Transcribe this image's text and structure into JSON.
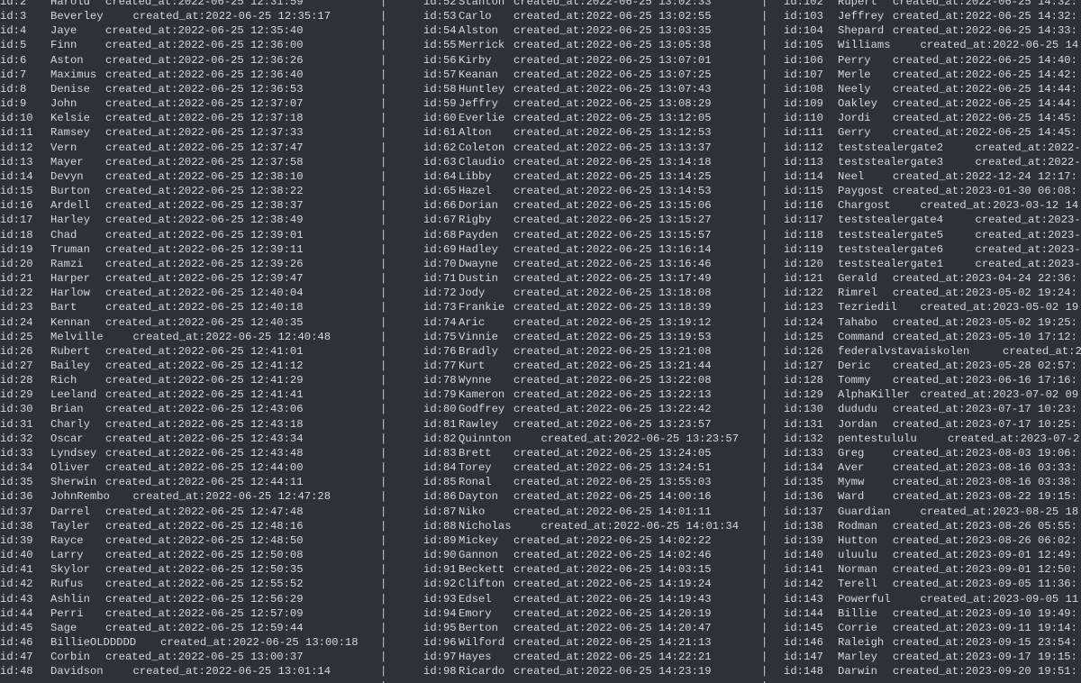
{
  "terminal": {
    "field_label": "created_at:",
    "separator": "|",
    "colors": {
      "background": "#2c313a",
      "text": "#d6d9de"
    },
    "columns": [
      {
        "rows": [
          {
            "id": "id:2",
            "name": "Harold",
            "created": "2022-06-25 12:31:59"
          },
          {
            "id": "id:3",
            "name": "Beverley",
            "created": "2022-06-25 12:35:17"
          },
          {
            "id": "id:4",
            "name": "Jaye",
            "created": "2022-06-25 12:35:40"
          },
          {
            "id": "id:5",
            "name": "Finn",
            "created": "2022-06-25 12:36:00"
          },
          {
            "id": "id:6",
            "name": "Aston",
            "created": "2022-06-25 12:36:26"
          },
          {
            "id": "id:7",
            "name": "Maximus",
            "created": "2022-06-25 12:36:40"
          },
          {
            "id": "id:8",
            "name": "Denise",
            "created": "2022-06-25 12:36:53"
          },
          {
            "id": "id:9",
            "name": "John",
            "created": "2022-06-25 12:37:07"
          },
          {
            "id": "id:10",
            "name": "Kelsie",
            "created": "2022-06-25 12:37:18"
          },
          {
            "id": "id:11",
            "name": "Ramsey",
            "created": "2022-06-25 12:37:33"
          },
          {
            "id": "id:12",
            "name": "Vern",
            "created": "2022-06-25 12:37:47"
          },
          {
            "id": "id:13",
            "name": "Mayer",
            "created": "2022-06-25 12:37:58"
          },
          {
            "id": "id:14",
            "name": "Devyn",
            "created": "2022-06-25 12:38:10"
          },
          {
            "id": "id:15",
            "name": "Burton",
            "created": "2022-06-25 12:38:22"
          },
          {
            "id": "id:16",
            "name": "Ardell",
            "created": "2022-06-25 12:38:37"
          },
          {
            "id": "id:17",
            "name": "Harley",
            "created": "2022-06-25 12:38:49"
          },
          {
            "id": "id:18",
            "name": "Chad",
            "created": "2022-06-25 12:39:01"
          },
          {
            "id": "id:19",
            "name": "Truman",
            "created": "2022-06-25 12:39:11"
          },
          {
            "id": "id:20",
            "name": "Ramzi",
            "created": "2022-06-25 12:39:26"
          },
          {
            "id": "id:21",
            "name": "Harper",
            "created": "2022-06-25 12:39:47"
          },
          {
            "id": "id:22",
            "name": "Harlow",
            "created": "2022-06-25 12:40:04"
          },
          {
            "id": "id:23",
            "name": "Bart",
            "created": "2022-06-25 12:40:18"
          },
          {
            "id": "id:24",
            "name": "Kennan",
            "created": "2022-06-25 12:40:35"
          },
          {
            "id": "id:25",
            "name": "Melville",
            "created": "2022-06-25 12:40:48"
          },
          {
            "id": "id:26",
            "name": "Rubert",
            "created": "2022-06-25 12:41:01"
          },
          {
            "id": "id:27",
            "name": "Bailey",
            "created": "2022-06-25 12:41:12"
          },
          {
            "id": "id:28",
            "name": "Rich",
            "created": "2022-06-25 12:41:29"
          },
          {
            "id": "id:29",
            "name": "Leeland",
            "created": "2022-06-25 12:41:41"
          },
          {
            "id": "id:30",
            "name": "Brian",
            "created": "2022-06-25 12:43:06"
          },
          {
            "id": "id:31",
            "name": "Charly",
            "created": "2022-06-25 12:43:18"
          },
          {
            "id": "id:32",
            "name": "Oscar",
            "created": "2022-06-25 12:43:34"
          },
          {
            "id": "id:33",
            "name": "Lyndsey",
            "created": "2022-06-25 12:43:48"
          },
          {
            "id": "id:34",
            "name": "Oliver",
            "created": "2022-06-25 12:44:00"
          },
          {
            "id": "id:35",
            "name": "Sherwin",
            "created": "2022-06-25 12:44:11"
          },
          {
            "id": "id:36",
            "name": "JohnRembo",
            "created": "2022-06-25 12:47:28"
          },
          {
            "id": "id:37",
            "name": "Darrel",
            "created": "2022-06-25 12:47:48"
          },
          {
            "id": "id:38",
            "name": "Tayler",
            "created": "2022-06-25 12:48:16"
          },
          {
            "id": "id:39",
            "name": "Rayce",
            "created": "2022-06-25 12:48:50"
          },
          {
            "id": "id:40",
            "name": "Larry",
            "created": "2022-06-25 12:50:08"
          },
          {
            "id": "id:41",
            "name": "Skylor",
            "created": "2022-06-25 12:50:35"
          },
          {
            "id": "id:42",
            "name": "Rufus",
            "created": "2022-06-25 12:55:52"
          },
          {
            "id": "id:43",
            "name": "Ashlin",
            "created": "2022-06-25 12:56:29"
          },
          {
            "id": "id:44",
            "name": "Perri",
            "created": "2022-06-25 12:57:09"
          },
          {
            "id": "id:45",
            "name": "Sage",
            "created": "2022-06-25 12:59:44"
          },
          {
            "id": "id:46",
            "name": "BillieOLDDDDD",
            "created": "2022-06-25 13:00:18"
          },
          {
            "id": "id:47",
            "name": "Corbin",
            "created": "2022-06-25 13:00:37"
          },
          {
            "id": "id:48",
            "name": "Davidson",
            "created": "2022-06-25 13:01:14"
          }
        ]
      },
      {
        "rows": [
          {
            "id": "id:52",
            "name": "Stanton",
            "created": "2022-06-25 13:02:33"
          },
          {
            "id": "id:53",
            "name": "Carlo",
            "created": "2022-06-25 13:02:55"
          },
          {
            "id": "id:54",
            "name": "Alston",
            "created": "2022-06-25 13:03:35"
          },
          {
            "id": "id:55",
            "name": "Merrick",
            "created": "2022-06-25 13:05:38"
          },
          {
            "id": "id:56",
            "name": "Kirby",
            "created": "2022-06-25 13:07:01"
          },
          {
            "id": "id:57",
            "name": "Keanan",
            "created": "2022-06-25 13:07:25"
          },
          {
            "id": "id:58",
            "name": "Huntley",
            "created": "2022-06-25 13:07:43"
          },
          {
            "id": "id:59",
            "name": "Jeffry",
            "created": "2022-06-25 13:08:29"
          },
          {
            "id": "id:60",
            "name": "Everlie",
            "created": "2022-06-25 13:12:05"
          },
          {
            "id": "id:61",
            "name": "Alton",
            "created": "2022-06-25 13:12:53"
          },
          {
            "id": "id:62",
            "name": "Coleton",
            "created": "2022-06-25 13:13:37"
          },
          {
            "id": "id:63",
            "name": "Claudio",
            "created": "2022-06-25 13:14:18"
          },
          {
            "id": "id:64",
            "name": "Libby",
            "created": "2022-06-25 13:14:25"
          },
          {
            "id": "id:65",
            "name": "Hazel",
            "created": "2022-06-25 13:14:53"
          },
          {
            "id": "id:66",
            "name": "Dorian",
            "created": "2022-06-25 13:15:06"
          },
          {
            "id": "id:67",
            "name": "Rigby",
            "created": "2022-06-25 13:15:27"
          },
          {
            "id": "id:68",
            "name": "Payden",
            "created": "2022-06-25 13:15:57"
          },
          {
            "id": "id:69",
            "name": "Hadley",
            "created": "2022-06-25 13:16:14"
          },
          {
            "id": "id:70",
            "name": "Dwayne",
            "created": "2022-06-25 13:16:46"
          },
          {
            "id": "id:71",
            "name": "Dustin",
            "created": "2022-06-25 13:17:49"
          },
          {
            "id": "id:72",
            "name": "Jody",
            "created": "2022-06-25 13:18:08"
          },
          {
            "id": "id:73",
            "name": "Frankie",
            "created": "2022-06-25 13:18:39"
          },
          {
            "id": "id:74",
            "name": "Aric",
            "created": "2022-06-25 13:19:12"
          },
          {
            "id": "id:75",
            "name": "Vinnie",
            "created": "2022-06-25 13:19:53"
          },
          {
            "id": "id:76",
            "name": "Bradly",
            "created": "2022-06-25 13:21:08"
          },
          {
            "id": "id:77",
            "name": "Kurt",
            "created": "2022-06-25 13:21:44"
          },
          {
            "id": "id:78",
            "name": "Wynne",
            "created": "2022-06-25 13:22:08"
          },
          {
            "id": "id:79",
            "name": "Kameron",
            "created": "2022-06-25 13:22:13"
          },
          {
            "id": "id:80",
            "name": "Godfrey",
            "created": "2022-06-25 13:22:42"
          },
          {
            "id": "id:81",
            "name": "Rawley",
            "created": "2022-06-25 13:23:57"
          },
          {
            "id": "id:82",
            "name": "Quinnton",
            "created": "2022-06-25 13:23:57"
          },
          {
            "id": "id:83",
            "name": "Brett",
            "created": "2022-06-25 13:24:05"
          },
          {
            "id": "id:84",
            "name": "Torey",
            "created": "2022-06-25 13:24:51"
          },
          {
            "id": "id:85",
            "name": "Ronal",
            "created": "2022-06-25 13:55:03"
          },
          {
            "id": "id:86",
            "name": "Dayton",
            "created": "2022-06-25 14:00:16"
          },
          {
            "id": "id:87",
            "name": "Niko",
            "created": "2022-06-25 14:01:11"
          },
          {
            "id": "id:88",
            "name": "Nicholas",
            "created": "2022-06-25 14:01:34"
          },
          {
            "id": "id:89",
            "name": "Mickey",
            "created": "2022-06-25 14:02:22"
          },
          {
            "id": "id:90",
            "name": "Gannon",
            "created": "2022-06-25 14:02:46"
          },
          {
            "id": "id:91",
            "name": "Beckett",
            "created": "2022-06-25 14:03:15"
          },
          {
            "id": "id:92",
            "name": "Clifton",
            "created": "2022-06-25 14:19:24"
          },
          {
            "id": "id:93",
            "name": "Edsel",
            "created": "2022-06-25 14:19:43"
          },
          {
            "id": "id:94",
            "name": "Emory",
            "created": "2022-06-25 14:20:19"
          },
          {
            "id": "id:95",
            "name": "Berton",
            "created": "2022-06-25 14:20:47"
          },
          {
            "id": "id:96",
            "name": "Wilford",
            "created": "2022-06-25 14:21:13"
          },
          {
            "id": "id:97",
            "name": "Hayes",
            "created": "2022-06-25 14:22:21"
          },
          {
            "id": "id:98",
            "name": "Ricardo",
            "created": "2022-06-25 14:23:19"
          }
        ]
      },
      {
        "rows": [
          {
            "id": "id:102",
            "name": "Rupert",
            "created": "2022-06-25 14:32:"
          },
          {
            "id": "id:103",
            "name": "Jeffrey",
            "created": "2022-06-25 14:32:"
          },
          {
            "id": "id:104",
            "name": "Shepard",
            "created": "2022-06-25 14:33:"
          },
          {
            "id": "id:105",
            "name": "Williams",
            "created": "2022-06-25 14"
          },
          {
            "id": "id:106",
            "name": "Perry",
            "created": "2022-06-25 14:40:"
          },
          {
            "id": "id:107",
            "name": "Merle",
            "created": "2022-06-25 14:42:"
          },
          {
            "id": "id:108",
            "name": "Neely",
            "created": "2022-06-25 14:44:"
          },
          {
            "id": "id:109",
            "name": "Oakley",
            "created": "2022-06-25 14:44:"
          },
          {
            "id": "id:110",
            "name": "Jordi",
            "created": "2022-06-25 14:45:"
          },
          {
            "id": "id:111",
            "name": "Gerry",
            "created": "2022-06-25 14:45:"
          },
          {
            "id": "id:112",
            "name": "teststealergate2",
            "created": "2022-"
          },
          {
            "id": "id:113",
            "name": "teststealergate3",
            "created": "2022-"
          },
          {
            "id": "id:114",
            "name": "Neel",
            "created": "2022-12-24 12:17:"
          },
          {
            "id": "id:115",
            "name": "Paygost",
            "created": "2023-01-30 06:08:"
          },
          {
            "id": "id:116",
            "name": "Chargost",
            "created": "2023-03-12 14"
          },
          {
            "id": "id:117",
            "name": "teststealergate4",
            "created": "2023-"
          },
          {
            "id": "id:118",
            "name": "teststealergate5",
            "created": "2023-"
          },
          {
            "id": "id:119",
            "name": "teststealergate6",
            "created": "2023-"
          },
          {
            "id": "id:120",
            "name": "teststealergate1",
            "created": "2023-"
          },
          {
            "id": "id:121",
            "name": "Gerald",
            "created": "2023-04-24 22:36:"
          },
          {
            "id": "id:122",
            "name": "Rimrel",
            "created": "2023-05-02 19:24:"
          },
          {
            "id": "id:123",
            "name": "Tezriedil",
            "created": "2023-05-02 19"
          },
          {
            "id": "id:124",
            "name": "Tahabo",
            "created": "2023-05-02 19:25:"
          },
          {
            "id": "id:125",
            "name": "Command",
            "created": "2023-05-10 17:12:"
          },
          {
            "id": "id:126",
            "name": "federalvstavaiskolen",
            "created": "2"
          },
          {
            "id": "id:127",
            "name": "Deric",
            "created": "2023-05-28 02:57:"
          },
          {
            "id": "id:128",
            "name": "Tommy",
            "created": "2023-06-16 17:16:"
          },
          {
            "id": "id:129",
            "name": "AlphaKiller",
            "created": "2023-07-02 09"
          },
          {
            "id": "id:130",
            "name": "dududu",
            "created": "2023-07-17 10:23:"
          },
          {
            "id": "id:131",
            "name": "Jordan",
            "created": "2023-07-17 10:25:"
          },
          {
            "id": "id:132",
            "name": "pentestululu",
            "created": "2023-07-2"
          },
          {
            "id": "id:133",
            "name": "Greg",
            "created": "2023-08-03 19:06:"
          },
          {
            "id": "id:134",
            "name": "Aver",
            "created": "2023-08-16 03:33:"
          },
          {
            "id": "id:135",
            "name": "Mymw",
            "created": "2023-08-16 03:38:"
          },
          {
            "id": "id:136",
            "name": "Ward",
            "created": "2023-08-22 19:15:"
          },
          {
            "id": "id:137",
            "name": "Guardian",
            "created": "2023-08-25 18"
          },
          {
            "id": "id:138",
            "name": "Rodman",
            "created": "2023-08-26 05:55:"
          },
          {
            "id": "id:139",
            "name": "Hutton",
            "created": "2023-08-26 06:02:"
          },
          {
            "id": "id:140",
            "name": "uluulu",
            "created": "2023-09-01 12:49:"
          },
          {
            "id": "id:141",
            "name": "Norman",
            "created": "2023-09-01 12:50:"
          },
          {
            "id": "id:142",
            "name": "Terell",
            "created": "2023-09-05 11:36:"
          },
          {
            "id": "id:143",
            "name": "Powerful",
            "created": "2023-09-05 11"
          },
          {
            "id": "id:144",
            "name": "Billie",
            "created": "2023-09-10 19:49:"
          },
          {
            "id": "id:145",
            "name": "Corrie",
            "created": "2023-09-11 19:14:"
          },
          {
            "id": "id:146",
            "name": "Raleigh",
            "created": "2023-09-15 23:54:"
          },
          {
            "id": "id:147",
            "name": "Marley",
            "created": "2023-09-17 19:15:"
          },
          {
            "id": "id:148",
            "name": "Darwin",
            "created": "2023-09-20 19:51:"
          }
        ]
      }
    ]
  }
}
